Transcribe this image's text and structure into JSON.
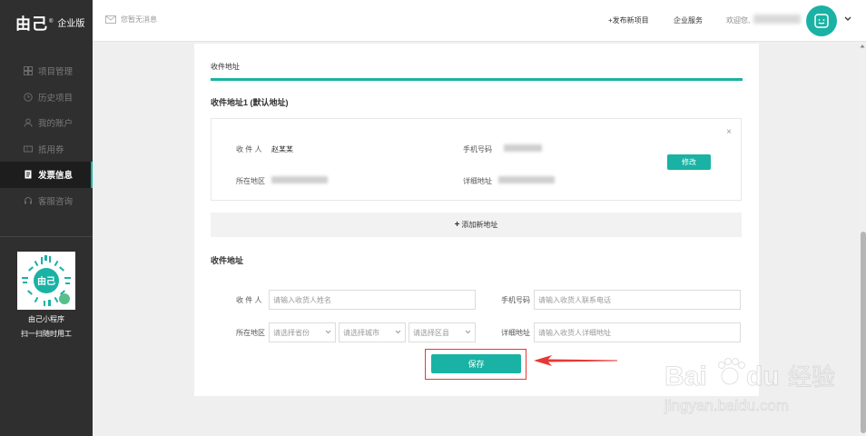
{
  "brand": {
    "name": "由己",
    "reg": "®",
    "edition": "企业版"
  },
  "sidebar": {
    "items": [
      {
        "label": "项目管理",
        "icon": "grid-icon",
        "active": false
      },
      {
        "label": "历史项目",
        "icon": "clock-icon",
        "active": false
      },
      {
        "label": "我的账户",
        "icon": "user-icon",
        "active": false
      },
      {
        "label": "抵用券",
        "icon": "coupon-icon",
        "active": false
      },
      {
        "label": "发票信息",
        "icon": "invoice-icon",
        "active": true
      },
      {
        "label": "客服咨询",
        "icon": "headset-icon",
        "active": false
      }
    ],
    "qr_caption_1": "由己小程序",
    "qr_caption_2": "扫一扫随时用工"
  },
  "topbar": {
    "message": "您暂无消息",
    "publish": "+发布新项目",
    "service": "企业服务",
    "welcome": "欢迎您,"
  },
  "card": {
    "tab": "收件地址",
    "saved_title": "收件地址1 (默认地址)",
    "saved": {
      "recipient_label": "收 件 人",
      "recipient_value": "赵某某",
      "phone_label": "手机号码",
      "region_label": "所在地区",
      "detail_label": "详细地址",
      "edit": "修改",
      "close": "×"
    },
    "add_new": "添加新地址",
    "form_title": "收件地址",
    "form": {
      "recipient_label": "收 件 人",
      "recipient_placeholder": "请输入收货人姓名",
      "phone_label": "手机号码",
      "phone_placeholder": "请输入收货人联系电话",
      "region_label": "所在地区",
      "province": "请选择省份",
      "city": "请选择城市",
      "district": "请选择区县",
      "detail_label": "详细地址",
      "detail_placeholder": "请输入收货人详细地址"
    },
    "save": "保存"
  },
  "watermark": {
    "logo": "Bai",
    "logo_tail": "du",
    "cn": "经验",
    "url": "jingyan.baidu.com"
  },
  "colors": {
    "accent": "#1ab2a4",
    "sidebar": "#2f2f2f",
    "highlight": "#e53935"
  }
}
